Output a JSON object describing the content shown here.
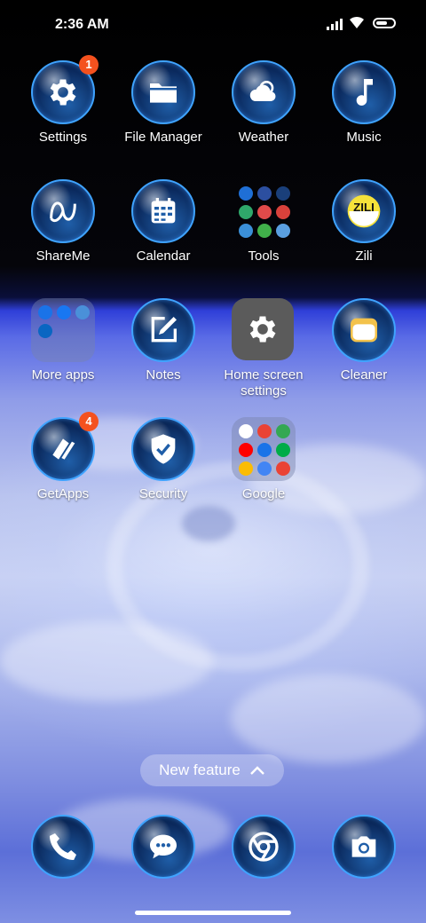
{
  "status": {
    "time": "2:36 AM"
  },
  "apps": [
    {
      "label": "Settings",
      "icon": "gear-icon",
      "badge": "1"
    },
    {
      "label": "File Manager",
      "icon": "folder-icon"
    },
    {
      "label": "Weather",
      "icon": "weather-icon"
    },
    {
      "label": "Music",
      "icon": "music-note-icon"
    },
    {
      "label": "ShareMe",
      "icon": "shareme-icon"
    },
    {
      "label": "Calendar",
      "icon": "calendar-icon"
    },
    {
      "label": "Tools",
      "icon": "tools-folder-icon"
    },
    {
      "label": "Zili",
      "icon": "zili-icon"
    },
    {
      "label": "More apps",
      "icon": "more-apps-folder-icon"
    },
    {
      "label": "Notes",
      "icon": "notes-icon"
    },
    {
      "label": "Home screen settings",
      "icon": "home-settings-gear-icon"
    },
    {
      "label": "Cleaner",
      "icon": "cleaner-icon"
    },
    {
      "label": "GetApps",
      "icon": "getapps-icon",
      "badge": "4"
    },
    {
      "label": "Security",
      "icon": "shield-icon"
    },
    {
      "label": "Google",
      "icon": "google-folder-icon"
    }
  ],
  "dock": [
    {
      "icon": "phone-icon"
    },
    {
      "icon": "messages-icon"
    },
    {
      "icon": "chrome-icon"
    },
    {
      "icon": "camera-icon"
    }
  ],
  "new_feature": {
    "label": "New feature"
  },
  "colors": {
    "badge": "#f4511e",
    "globe_ring": "#3fa3ff"
  }
}
